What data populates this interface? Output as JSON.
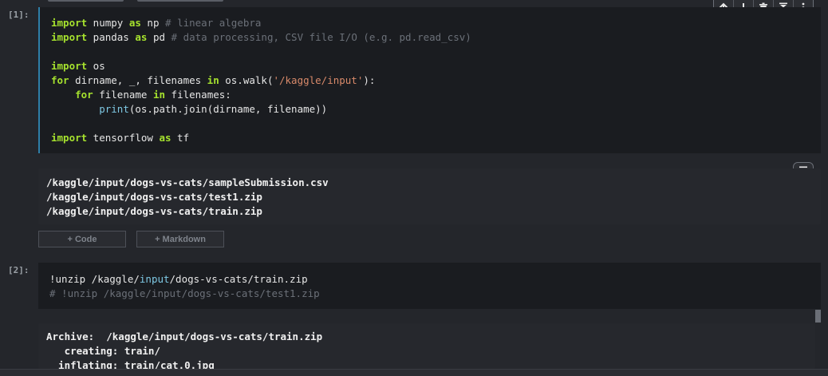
{
  "cell1": {
    "prompt": "[1]:",
    "lines": [
      [
        {
          "t": "import",
          "c": "kw"
        },
        {
          "t": " numpy ",
          "c": "plain"
        },
        {
          "t": "as",
          "c": "kw"
        },
        {
          "t": " np ",
          "c": "plain"
        },
        {
          "t": "# linear algebra",
          "c": "cm"
        }
      ],
      [
        {
          "t": "import",
          "c": "kw"
        },
        {
          "t": " pandas ",
          "c": "plain"
        },
        {
          "t": "as",
          "c": "kw"
        },
        {
          "t": " pd ",
          "c": "plain"
        },
        {
          "t": "# data processing, CSV file I/O (e.g. pd.read_csv)",
          "c": "cm"
        }
      ],
      [],
      [
        {
          "t": "import",
          "c": "kw"
        },
        {
          "t": " os",
          "c": "plain"
        }
      ],
      [
        {
          "t": "for",
          "c": "kw"
        },
        {
          "t": " dirname, _, filenames ",
          "c": "plain"
        },
        {
          "t": "in",
          "c": "kw"
        },
        {
          "t": " os.walk(",
          "c": "plain"
        },
        {
          "t": "'/kaggle/input'",
          "c": "str"
        },
        {
          "t": "):",
          "c": "plain"
        }
      ],
      [
        {
          "t": "    ",
          "c": "plain"
        },
        {
          "t": "for",
          "c": "kw"
        },
        {
          "t": " filename ",
          "c": "plain"
        },
        {
          "t": "in",
          "c": "kw"
        },
        {
          "t": " filenames:",
          "c": "plain"
        }
      ],
      [
        {
          "t": "        ",
          "c": "plain"
        },
        {
          "t": "print",
          "c": "fn"
        },
        {
          "t": "(os.path.join(dirname, filename))",
          "c": "plain"
        }
      ],
      [],
      [
        {
          "t": "import",
          "c": "kw"
        },
        {
          "t": " tensorflow ",
          "c": "plain"
        },
        {
          "t": "as",
          "c": "kw"
        },
        {
          "t": " tf",
          "c": "plain"
        }
      ]
    ],
    "output": [
      "/kaggle/input/dogs-vs-cats/sampleSubmission.csv",
      "/kaggle/input/dogs-vs-cats/test1.zip",
      "/kaggle/input/dogs-vs-cats/train.zip"
    ]
  },
  "add_cell": {
    "code_label": "+ Code",
    "markdown_label": "+ Markdown"
  },
  "cell2": {
    "prompt": "[2]:",
    "lines": [
      [
        {
          "t": "!unzip /kaggle/",
          "c": "plain"
        },
        {
          "t": "input",
          "c": "fn"
        },
        {
          "t": "/dogs-vs-cats/train.zip",
          "c": "plain"
        }
      ],
      [
        {
          "t": "# !unzip /kaggle/input/dogs-vs-cats/test1.zip",
          "c": "cm"
        }
      ]
    ],
    "output": [
      "Archive:  /kaggle/input/dogs-vs-cats/train.zip",
      "   creating: train/",
      "  inflating: train/cat.0.jpg"
    ]
  },
  "toolbar": {
    "icons": [
      "arrow-up-icon",
      "arrow-down-icon",
      "trash-icon",
      "collapse-icon",
      "more-icon"
    ]
  }
}
